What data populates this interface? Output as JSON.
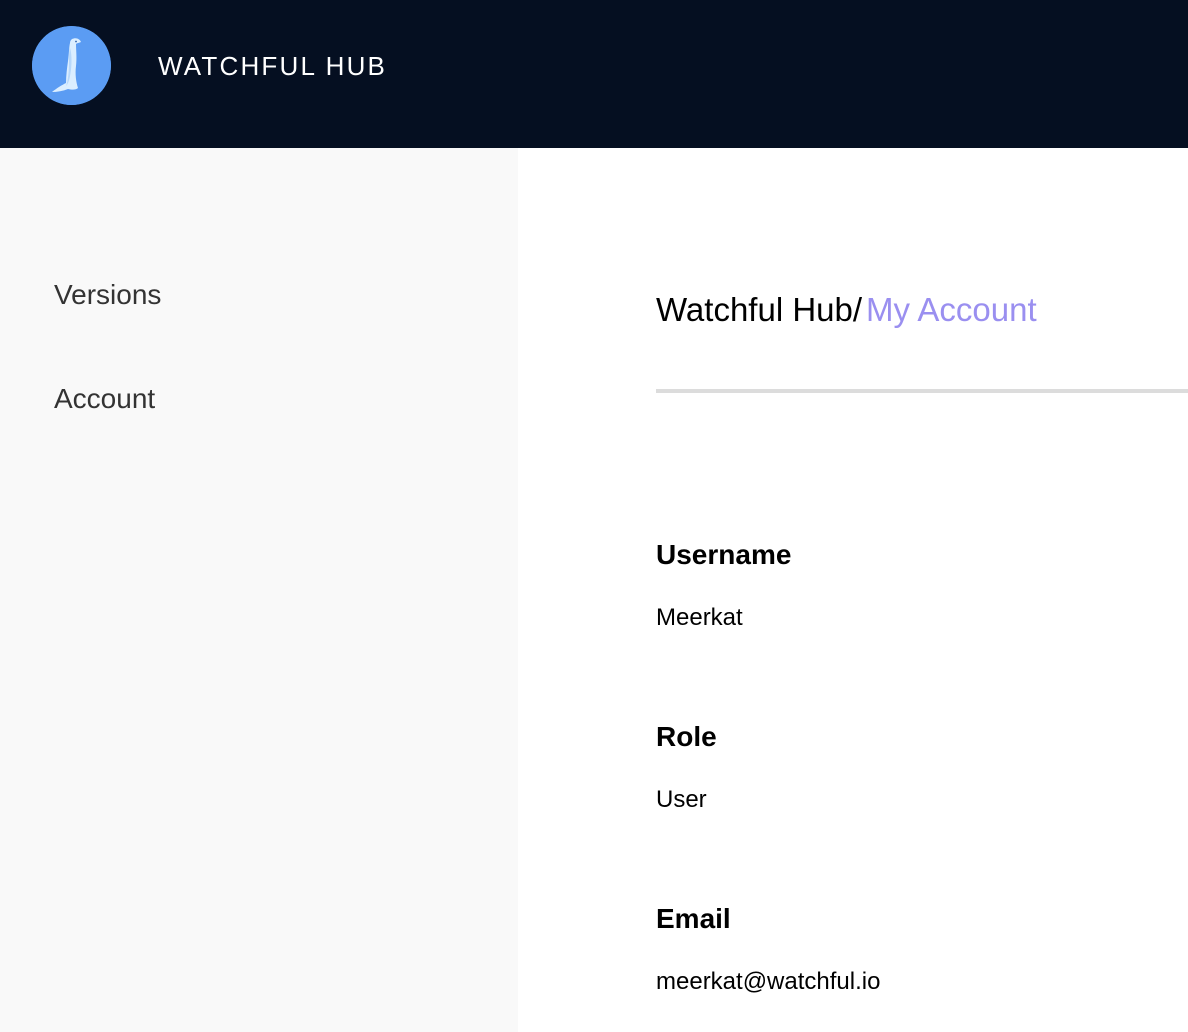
{
  "header": {
    "app_title": "WATCHFUL HUB",
    "logo_icon": "meerkat-logo-icon",
    "background_color": "#050f21",
    "logo_color": "#5b9cf3"
  },
  "sidebar": {
    "items": [
      {
        "label": "Versions"
      },
      {
        "label": "Account"
      }
    ]
  },
  "main": {
    "breadcrumb": {
      "root": "Watchful Hub/",
      "current": "My Account",
      "current_color": "#9a8ff0"
    },
    "fields": [
      {
        "label": "Username",
        "value": "Meerkat"
      },
      {
        "label": "Role",
        "value": "User"
      },
      {
        "label": "Email",
        "value": "meerkat@watchful.io"
      }
    ]
  }
}
